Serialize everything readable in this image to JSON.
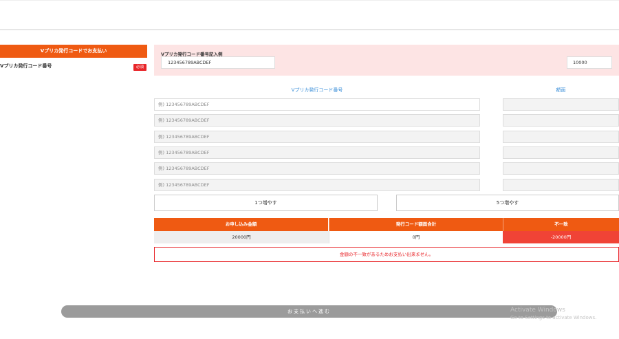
{
  "left": {
    "header": "Vプリカ発行コードでお支払い",
    "field_label": "Vプリカ発行コード番号",
    "required_badge": "必須"
  },
  "example": {
    "title": "Vプリカ発行コード番号記入例",
    "code": "123456789ABCDEF",
    "amount": "10000"
  },
  "columns": {
    "code": "Vプリカ発行コード番号",
    "amount": "額面"
  },
  "code_placeholder": "例) 123456789ABCDEF",
  "buttons": {
    "add_one": "1つ増やす",
    "add_five": "5つ増やす",
    "proceed": "お支払いへ進む"
  },
  "summary": {
    "headers": [
      "お申し込み金額",
      "発行コード額面合計",
      "不一致"
    ],
    "values": [
      "20000円",
      "0円",
      "-20000円"
    ]
  },
  "colors": {
    "accent": "#ef5a12",
    "error": "#e8262a",
    "panel_pink": "#fde4e4",
    "column_blue": "#3b8fd9"
  },
  "error_message": "金額の不一致があるためお支払い出来ません。",
  "watermark": {
    "line1": "Activate Windows",
    "line2": "Go to Settings to activate Windows."
  }
}
